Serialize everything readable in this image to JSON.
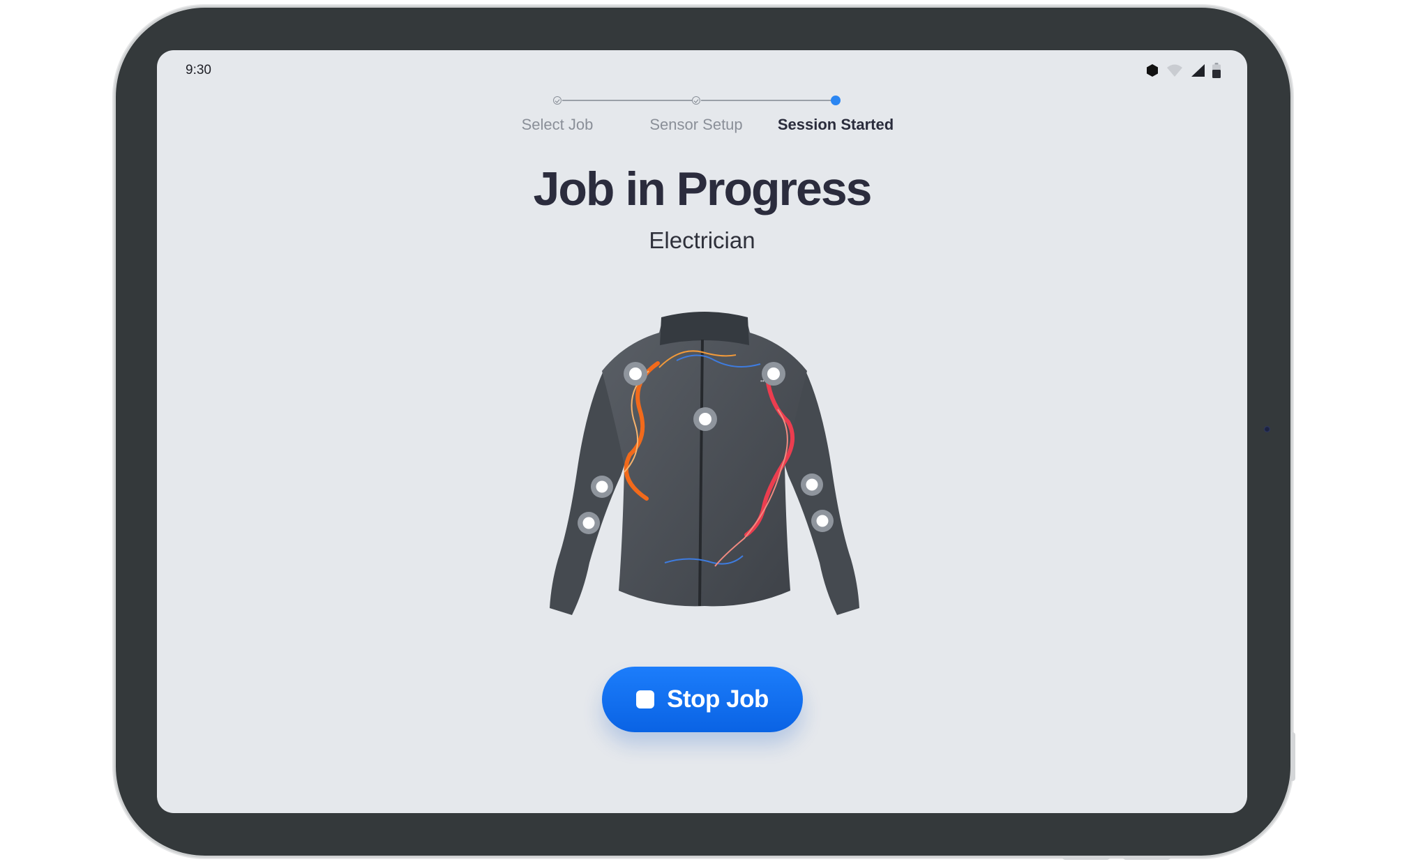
{
  "status_bar": {
    "time": "9:30",
    "icons": [
      "hexagon-icon",
      "wifi-icon",
      "signal-icon",
      "battery-icon"
    ]
  },
  "stepper": {
    "steps": [
      {
        "label": "Select Job",
        "state": "done"
      },
      {
        "label": "Sensor Setup",
        "state": "done"
      },
      {
        "label": "Session Started",
        "state": "active"
      }
    ]
  },
  "main": {
    "title": "Job in Progress",
    "subtitle": "Electrician"
  },
  "actions": {
    "stop_label": "Stop Job",
    "stop_icon": "stop-icon"
  },
  "colors": {
    "accent": "#1470F0",
    "screen_bg": "#E5E8EC",
    "jacket": "#4A4F55",
    "motion_orange": "#F26A1B",
    "motion_red": "#EC3D4F",
    "motion_blue": "#3E7CE0"
  }
}
